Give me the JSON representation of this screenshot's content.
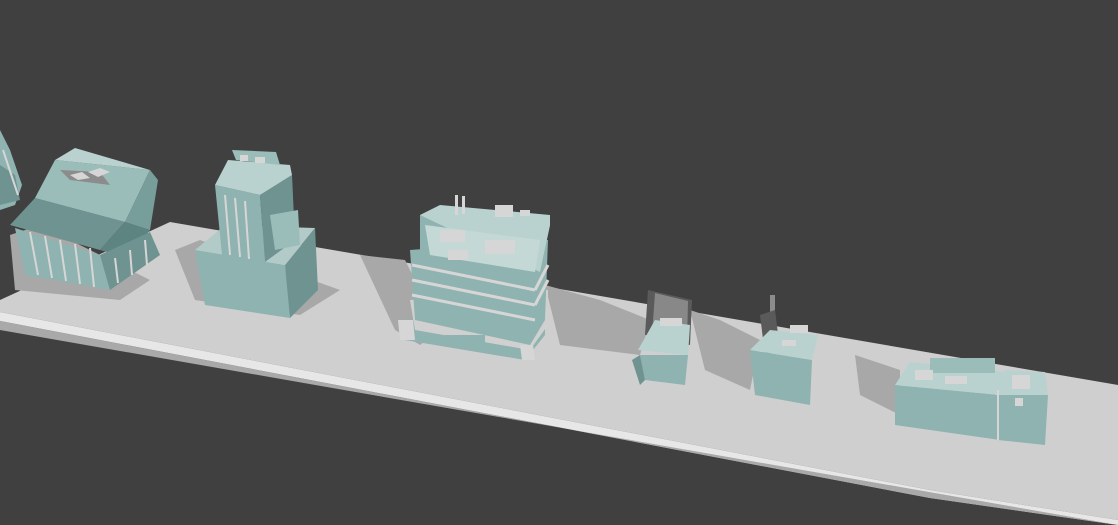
{
  "viewport": {
    "background_color": "#404040",
    "platform_color": "#cfcfcf",
    "platform_edge_color": "#e7e7e7",
    "platform_side_color": "#a9a9a9",
    "building_color": "#8fb3b0",
    "building_side_color": "#6e9391",
    "building_trim_color": "#d6d6d6"
  },
  "objects": [
    {
      "name": "partial-tower-edge"
    },
    {
      "name": "office-block-hip-roof"
    },
    {
      "name": "tower-on-podium"
    },
    {
      "name": "stacked-tech-building"
    },
    {
      "name": "small-kiosk-angled-panel"
    },
    {
      "name": "small-kiosk-with-antenna"
    },
    {
      "name": "low-wide-facility"
    }
  ]
}
